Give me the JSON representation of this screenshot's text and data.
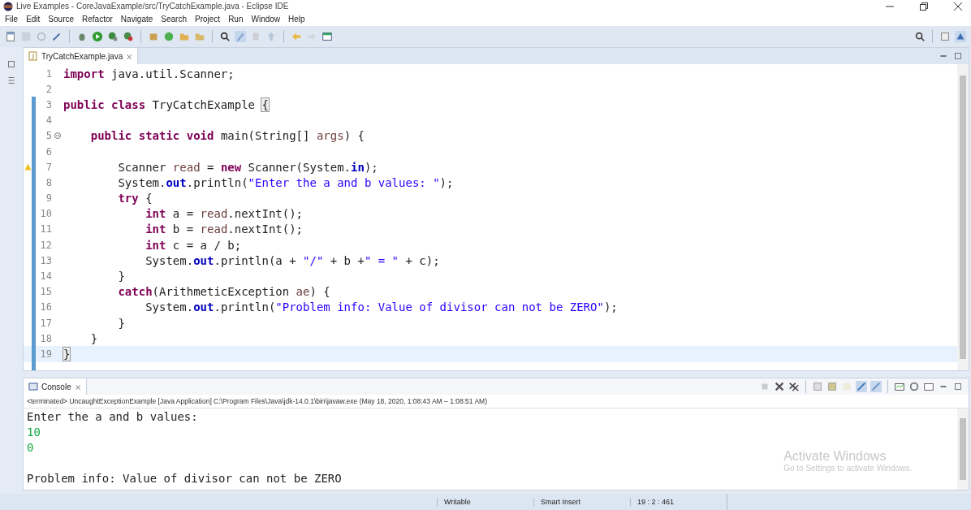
{
  "window": {
    "title": "Live Examples - CoreJavaExample/src/TryCatchExample.java - Eclipse IDE"
  },
  "menu": [
    "File",
    "Edit",
    "Source",
    "Refactor",
    "Navigate",
    "Search",
    "Project",
    "Run",
    "Window",
    "Help"
  ],
  "editor": {
    "tab": {
      "label": "TryCatchExample.java",
      "close": "⨯"
    },
    "lines": [
      {
        "number": "1",
        "kind": "plain",
        "current": false,
        "tokens": [
          {
            "kind": "keyword",
            "text": "import"
          },
          {
            "kind": "plain",
            "text": " java.util.Scanner;"
          }
        ]
      },
      {
        "number": "2",
        "kind": "plain",
        "current": false
      },
      {
        "number": "3",
        "kind": "plain",
        "current": false,
        "tokens": [
          {
            "kind": "keyword",
            "text": "public"
          },
          {
            "kind": "keyword",
            "text": " class"
          },
          {
            "kind": "plain",
            "text": " TryCatchExample "
          },
          {
            "kind": "match",
            "text": "{"
          }
        ]
      },
      {
        "number": "4",
        "kind": "plain",
        "current": false
      },
      {
        "number": "5",
        "kind": "fold",
        "current": false,
        "tokens": [
          {
            "kind": "keyword",
            "text": "    public"
          },
          {
            "kind": "keyword",
            "text": " static"
          },
          {
            "kind": "keyword",
            "text": " void"
          },
          {
            "kind": "plain",
            "text": " main(String[] "
          },
          {
            "kind": "variable",
            "text": "args"
          },
          {
            "kind": "plain",
            "text": ") {"
          }
        ]
      },
      {
        "number": "6",
        "kind": "plain",
        "current": false
      },
      {
        "number": "7",
        "kind": "warning",
        "current": false,
        "tokens": [
          {
            "kind": "plain",
            "text": "        Scanner "
          },
          {
            "kind": "variable",
            "text": "read"
          },
          {
            "kind": "plain",
            "text": " = "
          },
          {
            "kind": "keyword",
            "text": "new"
          },
          {
            "kind": "plain",
            "text": " Scanner(System."
          },
          {
            "kind": "field",
            "text": "in"
          },
          {
            "kind": "plain",
            "text": ");"
          }
        ]
      },
      {
        "number": "8",
        "kind": "plain",
        "current": false,
        "tokens": [
          {
            "kind": "plain",
            "text": "        System."
          },
          {
            "kind": "field",
            "text": "out"
          },
          {
            "kind": "plain",
            "text": ".println("
          },
          {
            "kind": "string",
            "text": "\"Enter the a and b values: \""
          },
          {
            "kind": "plain",
            "text": ");"
          }
        ]
      },
      {
        "number": "9",
        "kind": "plain",
        "current": false,
        "tokens": [
          {
            "kind": "keyword",
            "text": "        try"
          },
          {
            "kind": "plain",
            "text": " {"
          }
        ]
      },
      {
        "number": "10",
        "kind": "plain",
        "current": false,
        "tokens": [
          {
            "kind": "keyword",
            "text": "            int"
          },
          {
            "kind": "plain",
            "text": " a = "
          },
          {
            "kind": "variable",
            "text": "read"
          },
          {
            "kind": "plain",
            "text": ".nextInt();"
          }
        ]
      },
      {
        "number": "11",
        "kind": "plain",
        "current": false,
        "tokens": [
          {
            "kind": "keyword",
            "text": "            int"
          },
          {
            "kind": "plain",
            "text": " b = "
          },
          {
            "kind": "variable",
            "text": "read"
          },
          {
            "kind": "plain",
            "text": ".nextInt();"
          }
        ]
      },
      {
        "number": "12",
        "kind": "plain",
        "current": false,
        "tokens": [
          {
            "kind": "keyword",
            "text": "            int"
          },
          {
            "kind": "plain",
            "text": " c = a / b;"
          }
        ]
      },
      {
        "number": "13",
        "kind": "plain",
        "current": false,
        "tokens": [
          {
            "kind": "plain",
            "text": "            System."
          },
          {
            "kind": "field",
            "text": "out"
          },
          {
            "kind": "plain",
            "text": ".println(a + "
          },
          {
            "kind": "string",
            "text": "\"/\""
          },
          {
            "kind": "plain",
            "text": " + b +"
          },
          {
            "kind": "string",
            "text": "\" = \""
          },
          {
            "kind": "plain",
            "text": " + c);"
          }
        ]
      },
      {
        "number": "14",
        "kind": "plain",
        "current": false,
        "tokens": [
          {
            "kind": "plain",
            "text": "        }"
          }
        ]
      },
      {
        "number": "15",
        "kind": "plain",
        "current": false,
        "tokens": [
          {
            "kind": "keyword",
            "text": "        catch"
          },
          {
            "kind": "plain",
            "text": "(ArithmeticException "
          },
          {
            "kind": "variable",
            "text": "ae"
          },
          {
            "kind": "plain",
            "text": ") {"
          }
        ]
      },
      {
        "number": "16",
        "kind": "plain",
        "current": false,
        "tokens": [
          {
            "kind": "plain",
            "text": "            System."
          },
          {
            "kind": "field",
            "text": "out"
          },
          {
            "kind": "plain",
            "text": ".println("
          },
          {
            "kind": "string",
            "text": "\"Problem info: Value of divisor can not be ZERO\""
          },
          {
            "kind": "plain",
            "text": ");"
          }
        ]
      },
      {
        "number": "17",
        "kind": "plain",
        "current": false,
        "tokens": [
          {
            "kind": "plain",
            "text": "        }"
          }
        ]
      },
      {
        "number": "18",
        "kind": "plain",
        "current": false,
        "tokens": [
          {
            "kind": "plain",
            "text": "    }"
          }
        ]
      },
      {
        "number": "19",
        "kind": "plain",
        "current": true,
        "tokens": [
          {
            "kind": "match",
            "text": "}"
          }
        ]
      }
    ]
  },
  "console": {
    "tab": {
      "label": "Console",
      "close": "⨯"
    },
    "header": "<terminated> UncaughtExceptionExample [Java Application] C:\\Program Files\\Java\\jdk-14.0.1\\bin\\javaw.exe (May 18, 2020, 1:08:43 AM – 1:08:51 AM)",
    "output": [
      {
        "kind": "output",
        "text": "Enter the a and b values:"
      },
      {
        "kind": "input",
        "text": "10"
      },
      {
        "kind": "input",
        "text": "0"
      },
      {
        "kind": "blank"
      },
      {
        "kind": "output",
        "text": "Problem info: Value of divisor can not be ZERO"
      }
    ]
  },
  "activation_notice": {
    "title": "Activate Windows",
    "subtitle": "Go to Settings to activate Windows."
  },
  "status_bar": [
    "Writable",
    "Smart Insert",
    "19 : 2 : 461"
  ]
}
